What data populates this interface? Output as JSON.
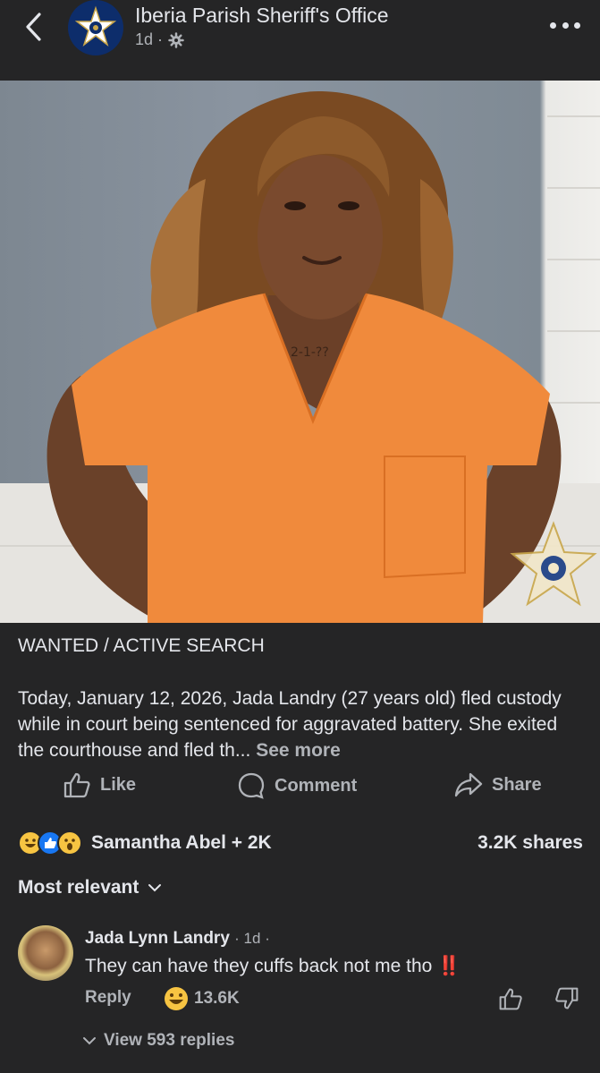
{
  "header": {
    "page_name": "Iberia Parish Sheriff's Office",
    "time": "1d ·"
  },
  "post": {
    "headline": "WANTED / ACTIVE SEARCH",
    "body": "Today, January 12, 2026, Jada Landry (27 years old) fled custody while in court being sentenced for aggravated battery. She exited the courthouse and fled th...",
    "see_more": "See more",
    "neck_tattoo": "2-1-??"
  },
  "actions": {
    "like": "Like",
    "comment": "Comment",
    "share": "Share"
  },
  "reactions": {
    "summary": "Samantha Abel + 2K",
    "shares": "3.2K shares"
  },
  "sort": {
    "label": "Most relevant"
  },
  "comment": {
    "author": "Jada Lynn Landry",
    "time": "· 1d ·",
    "text": "They can have they cuffs back not me tho",
    "emphasis": "‼️",
    "reply_label": "Reply",
    "reaction_count": "13.6K",
    "view_replies": "View 593 replies"
  },
  "colors": {
    "background": "#252526",
    "text": "#e4e6eb",
    "muted": "#b0b3b8",
    "jumpsuit": "#f08a3c",
    "wall": "#7f8a94"
  }
}
